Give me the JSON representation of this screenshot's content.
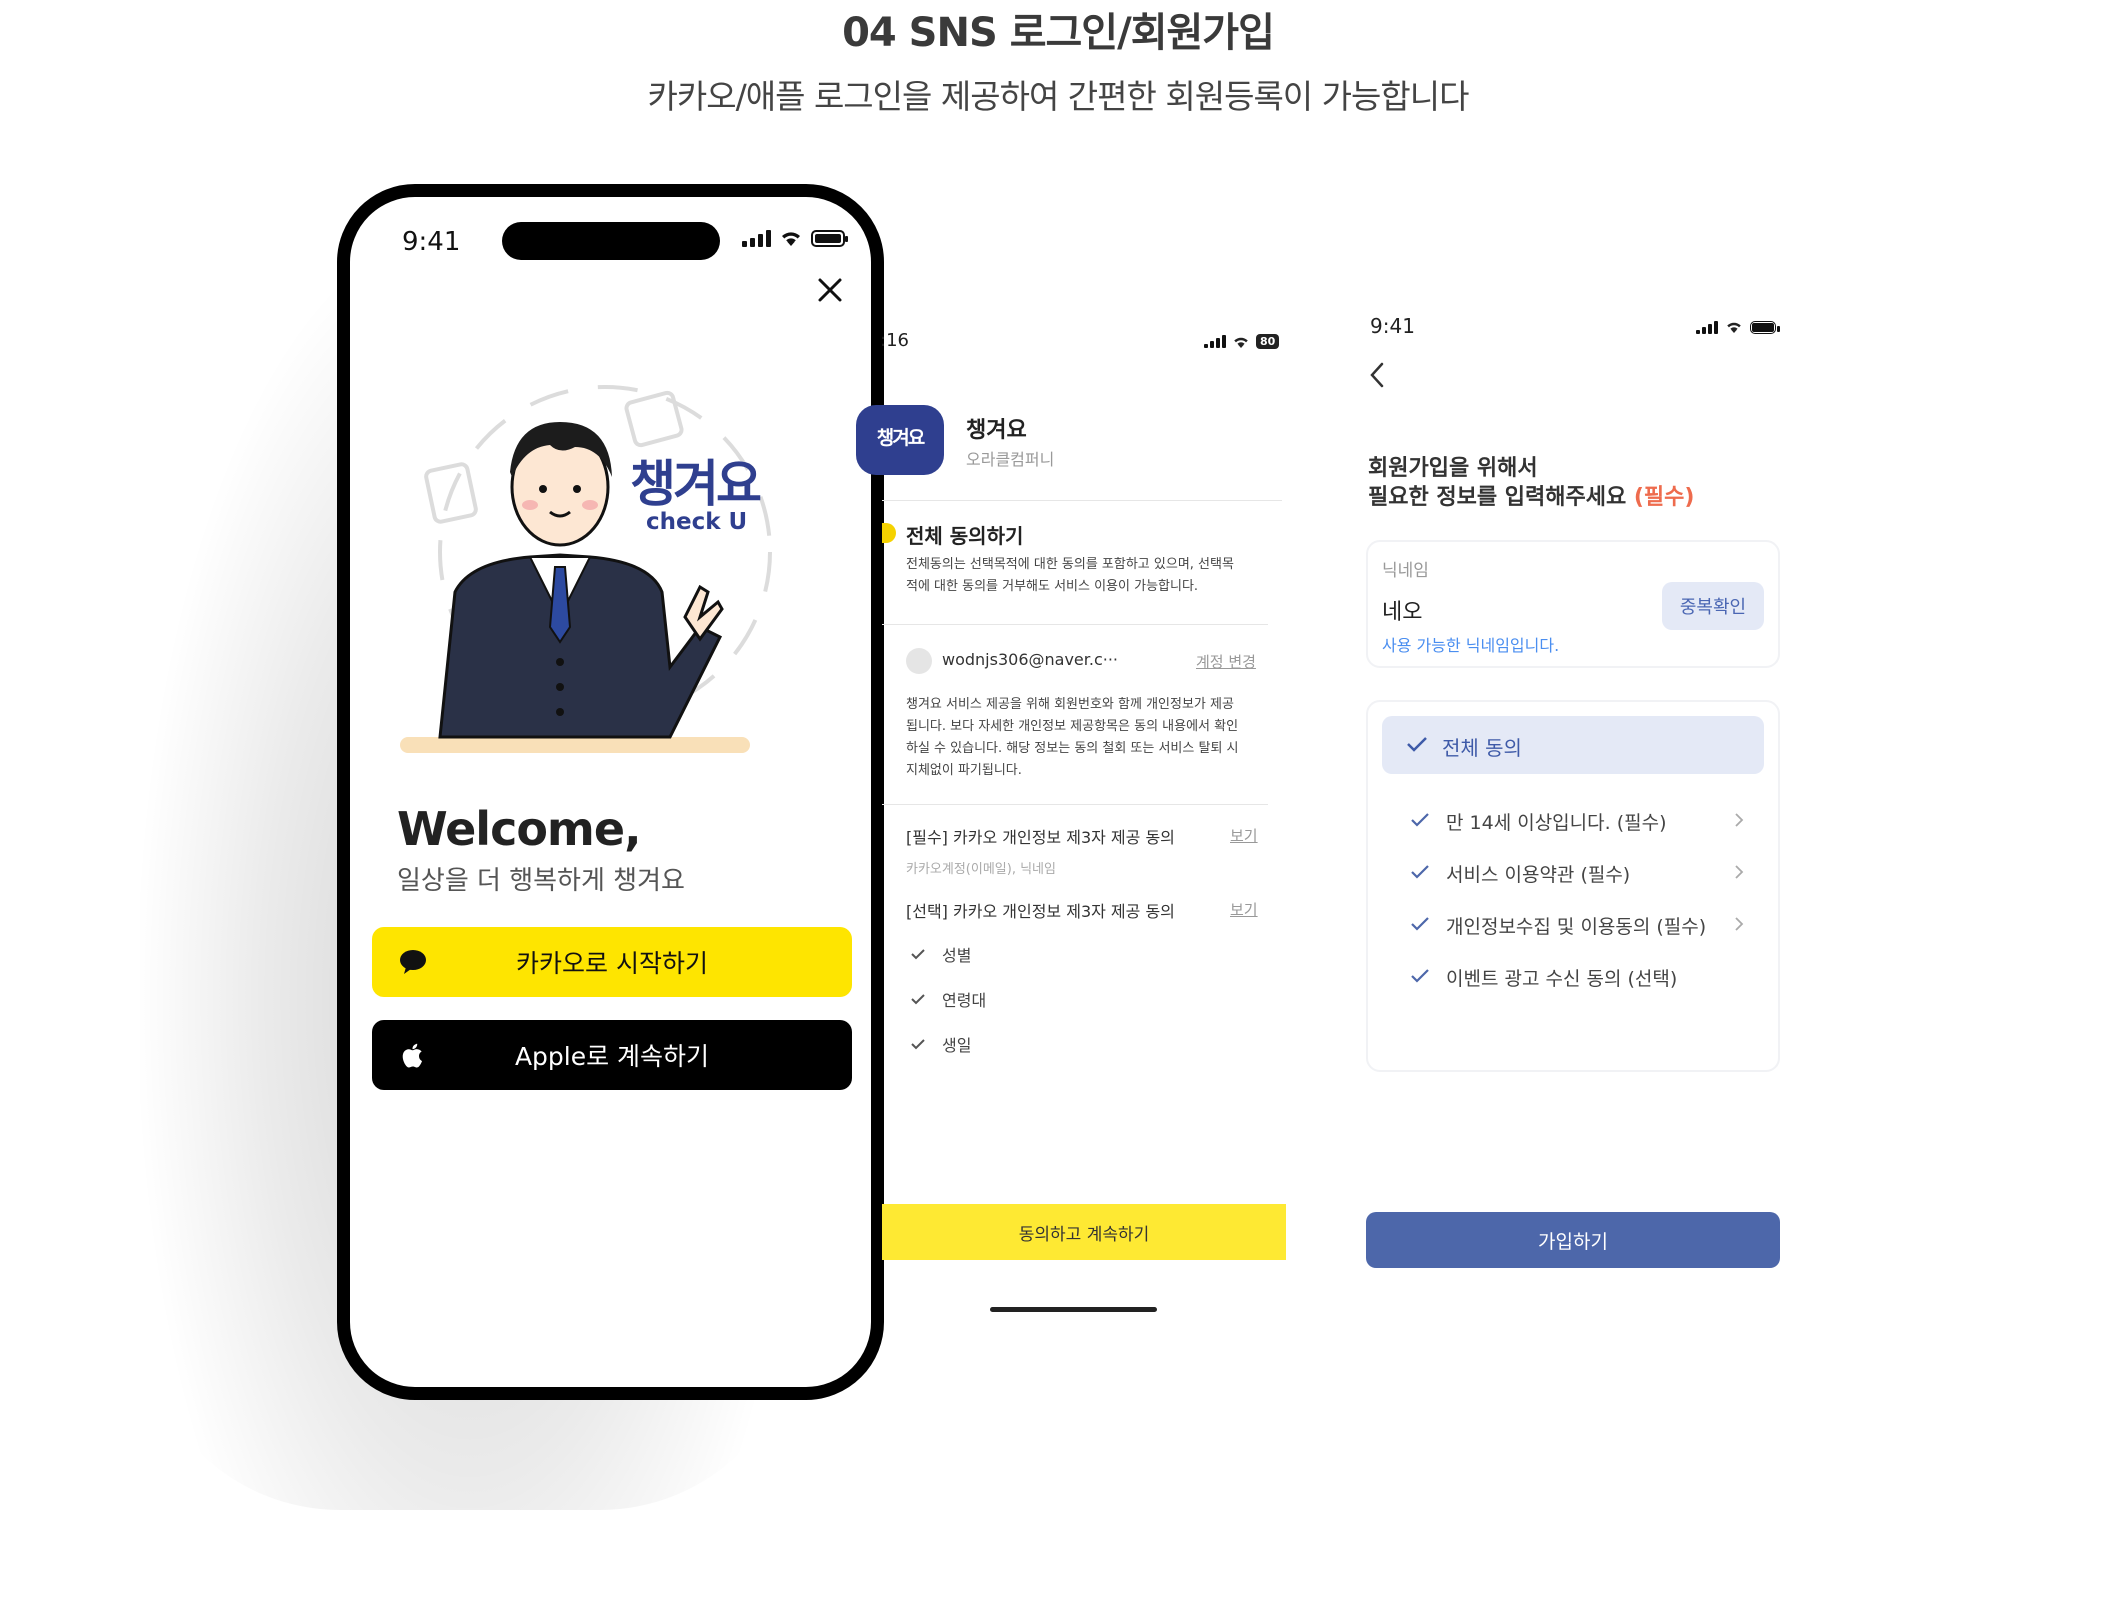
{
  "header": {
    "title": "04 SNS 로그인/회원가입",
    "subtitle": "카카오/애플 로그인을 제공하여 간편한 회원등록이 가능합니다"
  },
  "screen_login": {
    "time": "9:41",
    "logo_ko": "챙겨요",
    "logo_en": "check U",
    "welcome": "Welcome,",
    "welcome_sub": "일상을 더 행복하게 챙겨요",
    "kakao_button": "카카오로 시작하기",
    "apple_button": "Apple로 계속하기",
    "colors": {
      "kakao": "#fee500",
      "apple": "#000000",
      "brand": "#2f3f8f"
    }
  },
  "screen_kakao_consent": {
    "time": ":16",
    "battery": "80",
    "app_icon_text": "챙겨요",
    "app_name": "챙겨요",
    "company": "오라클컴퍼니",
    "all_agree": "전체 동의하기",
    "all_agree_desc": [
      "전체동의는 선택목적에 대한 동의를 포함하고 있으며, 선택목",
      "적에 대한 동의를 거부해도 서비스 이용이 가능합니다."
    ],
    "email": "wodnjs306@naver.c···",
    "change_account": "계정 변경",
    "privacy_desc": [
      "챙겨요 서비스 제공을 위해 회원번호와 함께 개인정보가 제공",
      "됩니다. 보다 자세한 개인정보 제공항목은 동의 내용에서 확인",
      "하실 수 있습니다. 해당 정보는 동의 철회 또는 서비스 탈퇴 시",
      "지체없이 파기됩니다."
    ],
    "required_item": "[필수] 카카오 개인정보 제3자 제공 동의",
    "required_sub": "카카오계정(이메일), 닉네임",
    "optional_item": "[선택] 카카오 개인정보 제3자 제공 동의",
    "view_label": "보기",
    "checks": [
      "성별",
      "연령대",
      "생일"
    ],
    "submit": "동의하고 계속하기"
  },
  "screen_signup": {
    "time": "9:41",
    "heading_line1": "회원가입을 위해서",
    "heading_line2": "필요한 정보를 입력해주세요",
    "required_tag": "(필수)",
    "nickname_label": "닉네임",
    "nickname_value": "네오",
    "dup_check": "중복확인",
    "nickname_hint": "사용 가능한 닉네임입니다.",
    "agree_all": "전체 동의",
    "agreements": [
      {
        "label": "만 14세 이상입니다. (필수)"
      },
      {
        "label": "서비스 이용약관 (필수)"
      },
      {
        "label": "개인정보수집 및 이용동의 (필수)"
      },
      {
        "label": "이벤트 광고 수신 동의 (선택)"
      }
    ],
    "submit": "가입하기",
    "colors": {
      "primary": "#4d67aa",
      "required": "#ee6b4d",
      "hint": "#4a8ef0"
    }
  }
}
